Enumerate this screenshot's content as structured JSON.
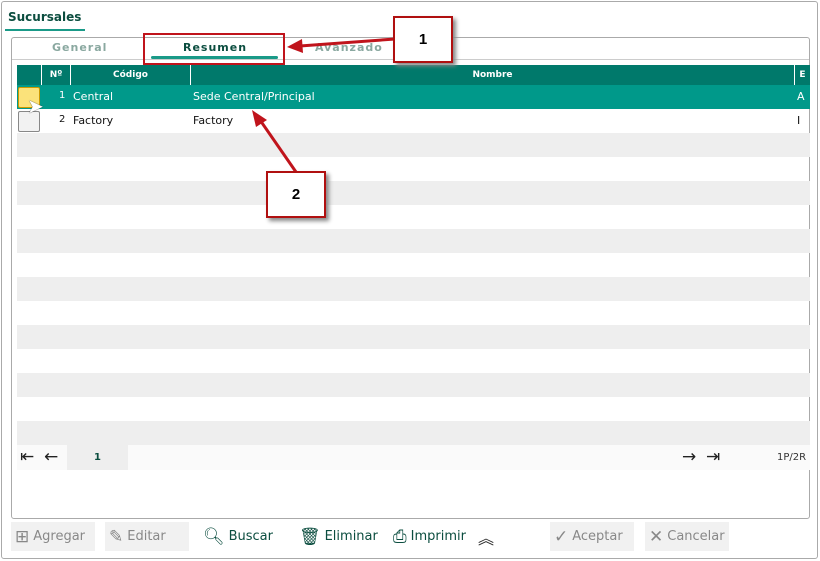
{
  "window": {
    "title": "Sucursales"
  },
  "tabs": [
    {
      "label": "General",
      "active": false
    },
    {
      "label": "Resumen",
      "active": true
    },
    {
      "label": "Avanzado",
      "active": false
    }
  ],
  "grid": {
    "columns": [
      "Nº",
      "Código",
      "Nombre",
      "E"
    ],
    "rows": [
      {
        "n": "1",
        "codigo": "Central",
        "nombre": "Sede Central/Principal",
        "e": "A",
        "selected": true
      },
      {
        "n": "2",
        "codigo": "Factory",
        "nombre": "Factory",
        "e": "I",
        "selected": false
      }
    ]
  },
  "pager": {
    "page": "1",
    "summary": "1P/2R"
  },
  "toolbar": {
    "add": "Agregar",
    "edit": "Editar",
    "search": "Buscar",
    "delete": "Eliminar",
    "print": "Imprimir",
    "accept": "Aceptar",
    "cancel": "Cancelar"
  },
  "annotations": {
    "a1": "1",
    "a2": "2"
  },
  "colors": {
    "accent": "#00998a",
    "header": "#00796b",
    "annotation": "#c0141c"
  }
}
